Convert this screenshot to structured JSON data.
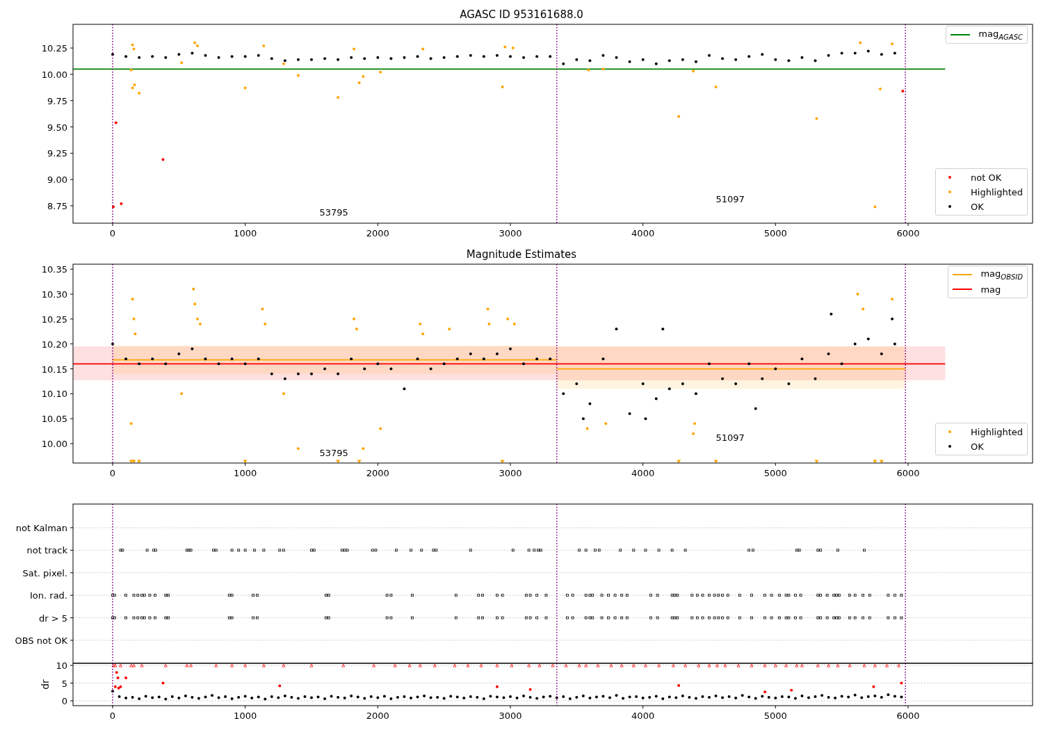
{
  "figure": {
    "panels": [
      {
        "charts": [
          {
            "chart_data": {
              "type": "scatter",
              "title": "AGASC ID 953161688.0",
              "xlim": [
                -299,
                6939
              ],
              "ylim": [
                8.585,
                10.475
              ],
              "xticks": [
                0,
                1000,
                2000,
                3000,
                4000,
                5000,
                6000
              ],
              "yticks": [
                {
                  "value": 8.75,
                  "label": "8.75"
                },
                {
                  "value": 9,
                  "label": "9.00"
                },
                {
                  "value": 9.25,
                  "label": "9.25"
                },
                {
                  "value": 9.5,
                  "label": "9.50"
                },
                {
                  "value": 9.75,
                  "label": "9.75"
                },
                {
                  "value": 10,
                  "label": "10.00"
                },
                {
                  "value": 10.25,
                  "label": "10.25"
                }
              ],
              "series": [
                {
                  "name": "mag$_{AGASC}$",
                  "type": "line",
                  "color": "#008000",
                  "x": [
                    -299,
                    6280
                  ],
                  "values": [
                    10.05,
                    10.05
                  ]
                },
                {
                  "name": "OK",
                  "color": "#000000",
                  "x": [
                    0,
                    100,
                    200,
                    300,
                    400,
                    500,
                    600,
                    700,
                    800,
                    900,
                    1000,
                    1100,
                    1200,
                    1300,
                    1400,
                    1500,
                    1600,
                    1700,
                    1800,
                    1900,
                    2000,
                    2100,
                    2200,
                    2300,
                    2400,
                    2500,
                    2600,
                    2700,
                    2800,
                    2900,
                    3000,
                    3100,
                    3200,
                    3300,
                    3400,
                    3500,
                    3600,
                    3700,
                    3800,
                    3900,
                    4000,
                    4100,
                    4200,
                    4300,
                    4400,
                    4500,
                    4600,
                    4700,
                    4800,
                    4900,
                    5000,
                    5100,
                    5200,
                    5300,
                    5400,
                    5500,
                    5600,
                    5700,
                    5800,
                    5900
                  ],
                  "values": [
                    10.19,
                    10.17,
                    10.16,
                    10.17,
                    10.16,
                    10.19,
                    10.2,
                    10.18,
                    10.16,
                    10.17,
                    10.17,
                    10.18,
                    10.15,
                    10.13,
                    10.14,
                    10.14,
                    10.15,
                    10.14,
                    10.16,
                    10.15,
                    10.16,
                    10.15,
                    10.16,
                    10.17,
                    10.15,
                    10.16,
                    10.17,
                    10.18,
                    10.17,
                    10.18,
                    10.17,
                    10.16,
                    10.17,
                    10.17,
                    10.1,
                    10.14,
                    10.13,
                    10.18,
                    10.16,
                    10.12,
                    10.14,
                    10.1,
                    10.13,
                    10.14,
                    10.12,
                    10.18,
                    10.15,
                    10.14,
                    10.17,
                    10.19,
                    10.14,
                    10.13,
                    10.16,
                    10.13,
                    10.18,
                    10.2,
                    10.2,
                    10.22,
                    10.19,
                    10.2
                  ]
                },
                {
                  "name": "Highlighted",
                  "color": "#ffa500",
                  "x": [
                    140,
                    150,
                    165,
                    200,
                    150,
                    160,
                    520,
                    620,
                    640,
                    1000,
                    1140,
                    1290,
                    1400,
                    1700,
                    1820,
                    1860,
                    1890,
                    2020,
                    2340,
                    2940,
                    2960,
                    3020,
                    3590,
                    3700,
                    4270,
                    4380,
                    4550,
                    5310,
                    5640,
                    5750,
                    5790,
                    5880
                  ],
                  "values": [
                    10.04,
                    9.87,
                    9.9,
                    9.82,
                    10.28,
                    10.24,
                    10.11,
                    10.3,
                    10.27,
                    9.87,
                    10.27,
                    10.1,
                    9.99,
                    9.78,
                    10.24,
                    9.92,
                    9.98,
                    10.02,
                    10.24,
                    9.88,
                    10.26,
                    10.25,
                    10.04,
                    10.05,
                    9.6,
                    10.03,
                    9.88,
                    9.58,
                    10.3,
                    8.74,
                    9.86,
                    10.29
                  ]
                },
                {
                  "name": "not OK",
                  "color": "#ff0000",
                  "x": [
                    5,
                    25,
                    65,
                    380,
                    5960
                  ],
                  "values": [
                    8.74,
                    9.54,
                    8.77,
                    9.19,
                    9.84
                  ]
                }
              ],
              "ref_lines": [
                {
                  "axis": "x",
                  "value": 0,
                  "color": "#800080"
                },
                {
                  "axis": "x",
                  "value": 3350,
                  "color": "#800080"
                },
                {
                  "axis": "x",
                  "value": 5980,
                  "color": "#800080"
                }
              ],
              "annotations": [
                "53795",
                "51097"
              ]
            }
          }
        ]
      },
      {
        "charts": [
          {
            "chart_data": {
              "type": "scatter",
              "title": "Magnitude Estimates",
              "xlim": [
                -299,
                6939
              ],
              "ylim": [
                9.961,
                10.36
              ],
              "xticks": [
                0,
                1000,
                2000,
                3000,
                4000,
                5000,
                6000
              ],
              "yticks": [
                {
                  "value": 10,
                  "label": "10.00"
                },
                {
                  "value": 10.05,
                  "label": "10.05"
                },
                {
                  "value": 10.1,
                  "label": "10.10"
                },
                {
                  "value": 10.15,
                  "label": "10.15"
                },
                {
                  "value": 10.2,
                  "label": "10.20"
                },
                {
                  "value": 10.25,
                  "label": "10.25"
                },
                {
                  "value": 10.3,
                  "label": "10.30"
                },
                {
                  "value": 10.35,
                  "label": "10.35"
                }
              ],
              "series": [
                {
                  "name": "mag$_{OBSID}$",
                  "type": "line",
                  "color": "#ffa500",
                  "x": [
                    0,
                    3350,
                    null,
                    3350,
                    5980
                  ],
                  "values": [
                    10.168,
                    10.168,
                    null,
                    10.15,
                    10.15
                  ]
                },
                {
                  "name": "mag",
                  "type": "line",
                  "color": "#ff0000",
                  "x": [
                    -299,
                    6280
                  ],
                  "values": [
                    10.16,
                    10.16
                  ]
                },
                {
                  "name": "OK",
                  "color": "#000000",
                  "x": [
                    0,
                    100,
                    200,
                    300,
                    400,
                    500,
                    600,
                    700,
                    800,
                    900,
                    1000,
                    1100,
                    1200,
                    1300,
                    1400,
                    1500,
                    1600,
                    1700,
                    1800,
                    1900,
                    2000,
                    2100,
                    2200,
                    2300,
                    2400,
                    2500,
                    2600,
                    2700,
                    2800,
                    2900,
                    3000,
                    3100,
                    3200,
                    3300,
                    3400,
                    3500,
                    3550,
                    3600,
                    3700,
                    3800,
                    3900,
                    4000,
                    4020,
                    4100,
                    4150,
                    4200,
                    4300,
                    4400,
                    4500,
                    4600,
                    4700,
                    4800,
                    4850,
                    4900,
                    5000,
                    5100,
                    5200,
                    5300,
                    5400,
                    5420,
                    5500,
                    5600,
                    5700,
                    5800,
                    5880,
                    5900
                  ],
                  "values": [
                    10.2,
                    10.17,
                    10.16,
                    10.17,
                    10.16,
                    10.18,
                    10.19,
                    10.17,
                    10.16,
                    10.17,
                    10.16,
                    10.17,
                    10.14,
                    10.13,
                    10.14,
                    10.14,
                    10.15,
                    10.14,
                    10.17,
                    10.15,
                    10.16,
                    10.15,
                    10.11,
                    10.17,
                    10.15,
                    10.16,
                    10.17,
                    10.18,
                    10.17,
                    10.18,
                    10.19,
                    10.16,
                    10.17,
                    10.17,
                    10.1,
                    10.12,
                    10.05,
                    10.08,
                    10.17,
                    10.23,
                    10.06,
                    10.12,
                    10.05,
                    10.09,
                    10.23,
                    10.11,
                    10.12,
                    10.1,
                    10.16,
                    10.13,
                    10.12,
                    10.16,
                    10.07,
                    10.13,
                    10.15,
                    10.12,
                    10.17,
                    10.13,
                    10.18,
                    10.26,
                    10.16,
                    10.2,
                    10.21,
                    10.18,
                    10.25,
                    10.2
                  ]
                },
                {
                  "name": "Highlighted",
                  "color": "#ffa500",
                  "x": [
                    140,
                    150,
                    160,
                    170,
                    520,
                    610,
                    620,
                    640,
                    660,
                    1130,
                    1150,
                    1290,
                    1400,
                    1820,
                    1840,
                    1890,
                    2020,
                    2320,
                    2340,
                    2540,
                    2830,
                    2840,
                    2980,
                    3030,
                    3580,
                    3720,
                    4380,
                    4390,
                    5620,
                    5660,
                    5880
                  ],
                  "values": [
                    10.04,
                    10.29,
                    10.25,
                    10.22,
                    10.1,
                    10.31,
                    10.28,
                    10.25,
                    10.24,
                    10.27,
                    10.24,
                    10.1,
                    9.99,
                    10.25,
                    10.23,
                    9.99,
                    10.03,
                    10.24,
                    10.22,
                    10.23,
                    10.27,
                    10.24,
                    10.25,
                    10.24,
                    10.03,
                    10.04,
                    10.02,
                    10.04,
                    10.3,
                    10.27,
                    10.29
                  ]
                },
                {
                  "color": "#ffa500",
                  "x": [
                    140,
                    160,
                    200,
                    1000,
                    1700,
                    1860,
                    2940,
                    4270,
                    4550,
                    5310,
                    5750,
                    5800
                  ],
                  "values": [
                    9.963,
                    9.963,
                    9.963,
                    9.963,
                    9.963,
                    9.963,
                    9.963,
                    9.963,
                    9.963,
                    9.963,
                    9.963,
                    9.963
                  ]
                }
              ],
              "bands": [
                {
                  "axis": "y",
                  "from": 10.127,
                  "to": 10.195,
                  "color": "#ff0000"
                },
                {
                  "axis": "y",
                  "from": 10.14,
                  "to": 10.197,
                  "color": "#ffa500"
                },
                {
                  "axis": "y",
                  "from": 10.11,
                  "to": 10.195,
                  "color": "#ffa500"
                }
              ],
              "ref_lines": [
                {
                  "axis": "x",
                  "value": 0,
                  "color": "#800080"
                },
                {
                  "axis": "x",
                  "value": 3350,
                  "color": "#800080"
                },
                {
                  "axis": "x",
                  "value": 5980,
                  "color": "#800080"
                }
              ],
              "annotations": [
                "53795",
                "51097"
              ]
            }
          }
        ]
      },
      {
        "flag_rows": [
          "not Kalman",
          "not track",
          "Sat. pixel.",
          "Ion. rad.",
          "dr > 5",
          "OBS not OK"
        ],
        "charts": [
          {
            "chart_data": {
              "type": "scatter",
              "ylabel": "dr",
              "grid": true,
              "xlim": [
                -299,
                6939
              ],
              "ylim": [
                -1.37,
                10.6
              ],
              "xticks": [
                0,
                1000,
                2000,
                3000,
                4000,
                5000,
                6000
              ],
              "yticks": [
                {
                  "value": 0,
                  "label": "0"
                },
                {
                  "value": 5,
                  "label": "5"
                },
                {
                  "value": 10,
                  "label": "10"
                }
              ],
              "series": [
                {
                  "color": "#000000",
                  "x": [
                    0,
                    50,
                    100,
                    150,
                    200,
                    250,
                    300,
                    350,
                    400,
                    450,
                    500,
                    550,
                    600,
                    650,
                    700,
                    750,
                    800,
                    850,
                    900,
                    950,
                    1000,
                    1050,
                    1100,
                    1150,
                    1200,
                    1250,
                    1300,
                    1350,
                    1400,
                    1450,
                    1500,
                    1550,
                    1600,
                    1650,
                    1700,
                    1750,
                    1800,
                    1850,
                    1900,
                    1950,
                    2000,
                    2050,
                    2100,
                    2150,
                    2200,
                    2250,
                    2300,
                    2350,
                    2400,
                    2450,
                    2500,
                    2550,
                    2600,
                    2650,
                    2700,
                    2750,
                    2800,
                    2850,
                    2900,
                    2950,
                    3000,
                    3050,
                    3100,
                    3150,
                    3200,
                    3250,
                    3300,
                    3350,
                    3400,
                    3450,
                    3500,
                    3550,
                    3600,
                    3650,
                    3700,
                    3750,
                    3800,
                    3850,
                    3900,
                    3950,
                    4000,
                    4050,
                    4100,
                    4150,
                    4200,
                    4250,
                    4300,
                    4350,
                    4400,
                    4450,
                    4500,
                    4550,
                    4600,
                    4650,
                    4700,
                    4750,
                    4800,
                    4850,
                    4900,
                    4950,
                    5000,
                    5050,
                    5100,
                    5150,
                    5200,
                    5250,
                    5300,
                    5350,
                    5400,
                    5450,
                    5500,
                    5550,
                    5600,
                    5650,
                    5700,
                    5750,
                    5800,
                    5850,
                    5900,
                    5950
                  ],
                  "values": [
                    2.7,
                    1.2,
                    0.8,
                    1,
                    0.6,
                    1.3,
                    0.9,
                    1.1,
                    0.5,
                    1.2,
                    0.8,
                    1.4,
                    1,
                    0.7,
                    1.1,
                    1.5,
                    0.9,
                    1.2,
                    0.6,
                    1,
                    1.3,
                    0.8,
                    1.1,
                    0.5,
                    1.2,
                    0.9,
                    1.4,
                    1,
                    0.7,
                    1.2,
                    0.9,
                    1.1,
                    0.6,
                    1.3,
                    1,
                    0.8,
                    1.4,
                    1.1,
                    0.7,
                    1.2,
                    0.9,
                    1.3,
                    0.6,
                    1,
                    1.2,
                    0.8,
                    1.1,
                    1.4,
                    0.9,
                    1,
                    0.7,
                    1.3,
                    1.1,
                    0.8,
                    1.2,
                    1,
                    0.6,
                    1.3,
                    1.1,
                    0.9,
                    1.2,
                    0.8,
                    1.4,
                    1,
                    0.7,
                    1.1,
                    1.3,
                    0.9,
                    1.2,
                    0.6,
                    1,
                    1.4,
                    0.8,
                    1.1,
                    1.3,
                    0.9,
                    1.5,
                    0.7,
                    1.1,
                    1.2,
                    0.8,
                    1,
                    1.3,
                    0.6,
                    1.1,
                    0.9,
                    1.4,
                    1,
                    0.7,
                    1.2,
                    1,
                    1.4,
                    0.9,
                    1.2,
                    0.8,
                    1.5,
                    1.1,
                    0.7,
                    1.3,
                    1,
                    0.8,
                    1.2,
                    1.1,
                    0.7,
                    1.4,
                    0.9,
                    1.2,
                    1.5,
                    1,
                    0.8,
                    1.3,
                    1.1,
                    1.6,
                    0.9,
                    1.2,
                    1.4,
                    1,
                    1.7,
                    1.3,
                    1.1
                  ]
                },
                {
                  "color": "#ff0000",
                  "x": [
                    45,
                    20,
                    30,
                    40,
                    60,
                    100,
                    380,
                    1260,
                    2900,
                    3150,
                    4270,
                    4920,
                    5120,
                    5740,
                    5950
                  ],
                  "values": [
                    3.6,
                    4,
                    8,
                    6.5,
                    4,
                    6.5,
                    5,
                    4.2,
                    4,
                    3.2,
                    4.3,
                    2.5,
                    3,
                    4,
                    5
                  ]
                },
                {
                  "color": "#ff0000",
                  "x": [
                    5,
                    20,
                    60,
                    140,
                    160,
                    220,
                    400,
                    560,
                    590,
                    780,
                    900,
                    1000,
                    1140,
                    1290,
                    1500,
                    1740,
                    1970,
                    2130,
                    2240,
                    2320,
                    2430,
                    2580,
                    2680,
                    2780,
                    2900,
                    3010,
                    3140,
                    3220,
                    3320,
                    3420,
                    3520,
                    3570,
                    3660,
                    3760,
                    3840,
                    3930,
                    4020,
                    4120,
                    4230,
                    4320,
                    4420,
                    4500,
                    4560,
                    4620,
                    4720,
                    4820,
                    4920,
                    5000,
                    5080,
                    5160,
                    5200,
                    5320,
                    5400,
                    5470,
                    5560,
                    5670,
                    5750,
                    5840,
                    5930
                  ],
                  "values": [
                    10,
                    10,
                    10,
                    10,
                    10,
                    10,
                    10,
                    10,
                    10,
                    10,
                    10,
                    10,
                    10,
                    10,
                    10,
                    10,
                    10,
                    10,
                    10,
                    10,
                    10,
                    10,
                    10,
                    10,
                    10,
                    10,
                    10,
                    10,
                    10,
                    10,
                    10,
                    10,
                    10,
                    10,
                    10,
                    10,
                    10,
                    10,
                    10,
                    10,
                    10,
                    10,
                    10,
                    10,
                    10,
                    10,
                    10,
                    10,
                    10,
                    10,
                    10,
                    10,
                    10,
                    10,
                    10,
                    10,
                    10,
                    10,
                    10
                  ]
                }
              ],
              "ref_lines": [
                {
                  "axis": "x",
                  "value": 0,
                  "color": "#800080"
                },
                {
                  "axis": "x",
                  "value": 3350,
                  "color": "#800080"
                },
                {
                  "axis": "x",
                  "value": 5980,
                  "color": "#800080"
                }
              ]
            }
          }
        ]
      }
    ]
  }
}
